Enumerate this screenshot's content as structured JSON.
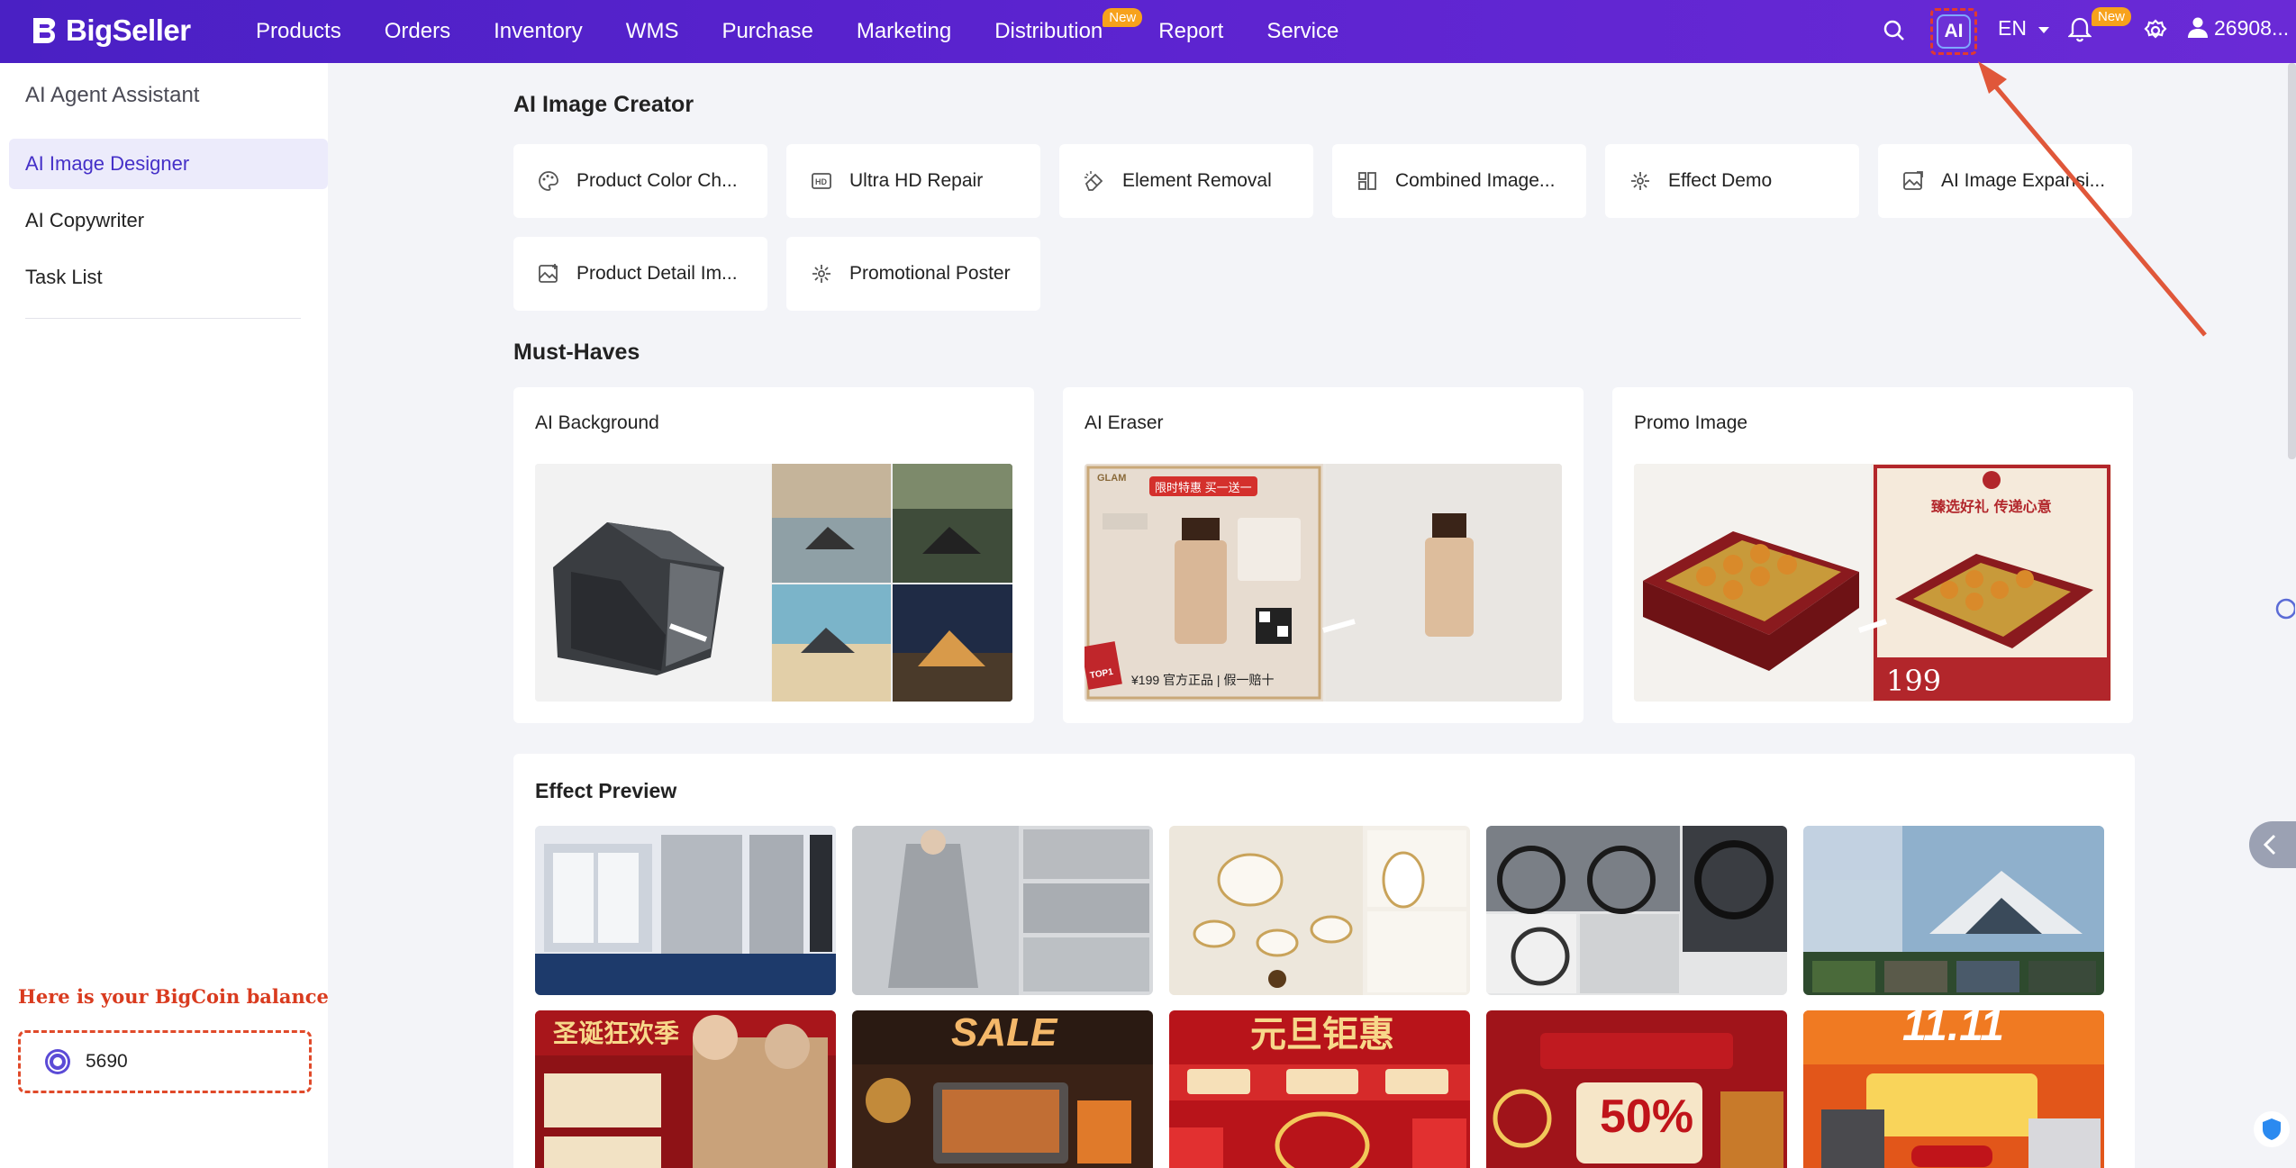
{
  "app": {
    "logo_text": "BigSeller"
  },
  "nav": {
    "items": [
      "Products",
      "Orders",
      "Inventory",
      "WMS",
      "Purchase",
      "Marketing",
      "Distribution",
      "Report",
      "Service"
    ],
    "distribution_badge": "New"
  },
  "topbar": {
    "ai_label": "AI",
    "language": "EN",
    "notification_badge": "New",
    "user_name": "26908..."
  },
  "sidebar": {
    "title": "AI Agent Assistant",
    "items": [
      {
        "label": "AI Image Designer",
        "active": true
      },
      {
        "label": "AI Copywriter",
        "active": false
      },
      {
        "label": "Task List",
        "active": false
      }
    ],
    "balance_hint": "Here is your BigCoin balance",
    "balance_value": "5690"
  },
  "creator": {
    "title": "AI Image Creator",
    "tools": [
      {
        "label": "Product Color Ch...",
        "icon": "palette-icon"
      },
      {
        "label": "Ultra HD Repair",
        "icon": "hd-icon"
      },
      {
        "label": "Element Removal",
        "icon": "eraser-icon"
      },
      {
        "label": "Combined Image...",
        "icon": "grid-icon"
      },
      {
        "label": "Effect Demo",
        "icon": "sparkle-icon"
      },
      {
        "label": "AI Image Expansi...",
        "icon": "image-expand-icon"
      },
      {
        "label": "Product Detail Im...",
        "icon": "image-plus-icon"
      },
      {
        "label": "Promotional Poster",
        "icon": "sparkle-icon"
      }
    ]
  },
  "must_haves": {
    "title": "Must-Haves",
    "cards": [
      {
        "label": "AI Background"
      },
      {
        "label": "AI Eraser",
        "promo_text": "限时特惠 买一送一",
        "price_text": "¥199 官方正品 | 假一赔十",
        "brand": "GLAM",
        "badge": "TOP1"
      },
      {
        "label": "Promo Image",
        "headline": "臻选好礼 传递心意",
        "price": "199"
      }
    ]
  },
  "effect_preview": {
    "title": "Effect Preview",
    "row2_texts": [
      "圣诞狂欢季",
      "SALE",
      "元旦钜惠",
      "50%",
      "11.11"
    ]
  },
  "colors": {
    "accent": "#5b23cf",
    "highlight": "#e04a2a"
  }
}
